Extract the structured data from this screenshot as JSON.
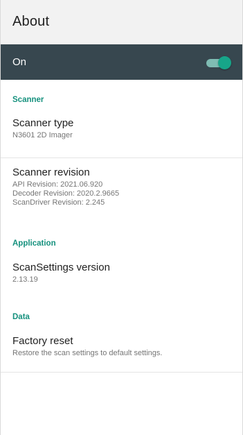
{
  "appbar": {
    "title": "About"
  },
  "master_switch": {
    "label": "On",
    "state": "on",
    "accent_color": "#17a589"
  },
  "sections": {
    "scanner": {
      "header": "Scanner",
      "scanner_type": {
        "title": "Scanner type",
        "summary": "N3601 2D Imager"
      },
      "scanner_revision": {
        "title": "Scanner revision",
        "lines": [
          "API Revision: 2021.06.920",
          "Decoder Revision: 2020.2.9665",
          "ScanDriver Revision: 2.245"
        ]
      }
    },
    "application": {
      "header": "Application",
      "scansettings_version": {
        "title": "ScanSettings version",
        "summary": "2.13.19"
      }
    },
    "data": {
      "header": "Data",
      "factory_reset": {
        "title": "Factory reset",
        "summary": "Restore the scan settings to default settings."
      }
    }
  }
}
